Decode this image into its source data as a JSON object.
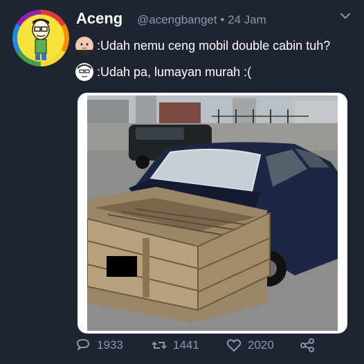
{
  "tweet": {
    "author_name": "Aceng",
    "handle": "@acengbanget",
    "time": "24 Jam",
    "separator": "•",
    "lines": [
      {
        "text": ":Udah nemu ceng mobil double cabin tuh?",
        "icon": "baby-face-icon"
      },
      {
        "text": ":Udah pa, lumayan murah :(",
        "icon": "cartoon-face-icon"
      }
    ],
    "stats": {
      "replies": "1933",
      "retweets": "1441",
      "likes": "2020"
    }
  },
  "colors": {
    "background": "#1e2432",
    "muted": "#8c97a8",
    "text": "#ffffff"
  }
}
